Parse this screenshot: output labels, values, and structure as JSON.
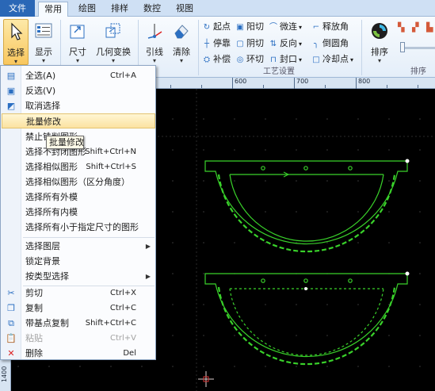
{
  "tabs": [
    "文件",
    "常用",
    "绘图",
    "排样",
    "数控",
    "视图"
  ],
  "ribbon": {
    "select_label": "选择",
    "display_label": "显示",
    "size_label": "尺寸",
    "geometry_label": "几何变换",
    "lead_label": "引线",
    "clear_label": "清除",
    "process_buttons": {
      "start": "起点",
      "stop": "停靠",
      "compensate": "补偿",
      "yang_cut": "阳切",
      "yin_cut": "阴切",
      "ring_cut": "环切",
      "micro_link": "微连",
      "reverse": "反向",
      "seal": "封口",
      "release_corner": "释放角",
      "chamfer": "倒圆角",
      "cool_point": "冷却点"
    },
    "process_group_label": "工艺设置",
    "sort_label": "排序",
    "sort_group_label": "排序"
  },
  "ruler": {
    "ticks": [
      "600",
      "700",
      "800"
    ],
    "left_label": "1400"
  },
  "colors": {
    "ribbon_bg": "#eaf2fb",
    "canvas_bg": "#000000",
    "shape_green": "#39d12a",
    "grid_dot": "#3b3b3b"
  },
  "menu": {
    "items": [
      {
        "label": "全选(A)",
        "shortcut": "Ctrl+A",
        "icon": "select-all-icon"
      },
      {
        "label": "反选(V)",
        "shortcut": "",
        "icon": "invert-select-icon"
      },
      {
        "label": "取消选择",
        "shortcut": "",
        "icon": "deselect-icon"
      },
      {
        "label": "批量修改",
        "shortcut": "",
        "icon": ""
      },
      {
        "label": "禁止铣削图形",
        "shortcut": "",
        "icon": ""
      },
      {
        "label": "选择不封闭图形",
        "shortcut": "Shift+Ctrl+N",
        "icon": ""
      },
      {
        "label": "选择相似图形",
        "shortcut": "Shift+Ctrl+S",
        "icon": ""
      },
      {
        "label": "选择相似图形（区分角度）",
        "shortcut": "",
        "icon": ""
      },
      {
        "label": "选择所有外模",
        "shortcut": "",
        "icon": ""
      },
      {
        "label": "选择所有内模",
        "shortcut": "",
        "icon": ""
      },
      {
        "label": "选择所有小于指定尺寸的图形",
        "shortcut": "",
        "icon": ""
      },
      {
        "label": "选择图层",
        "shortcut": "",
        "icon": ""
      },
      {
        "label": "锁定背景",
        "shortcut": "",
        "icon": ""
      },
      {
        "label": "按类型选择",
        "shortcut": "",
        "icon": ""
      },
      {
        "label": "剪切",
        "shortcut": "Ctrl+X",
        "icon": "scissors-icon"
      },
      {
        "label": "复制",
        "shortcut": "Ctrl+C",
        "icon": "copy-icon"
      },
      {
        "label": "带基点复制",
        "shortcut": "Shift+Ctrl+C",
        "icon": "copy-base-icon"
      },
      {
        "label": "粘贴",
        "shortcut": "Ctrl+V",
        "icon": "paste-icon"
      },
      {
        "label": "删除",
        "shortcut": "Del",
        "icon": "delete-icon"
      }
    ],
    "tooltip": "批量修改"
  }
}
